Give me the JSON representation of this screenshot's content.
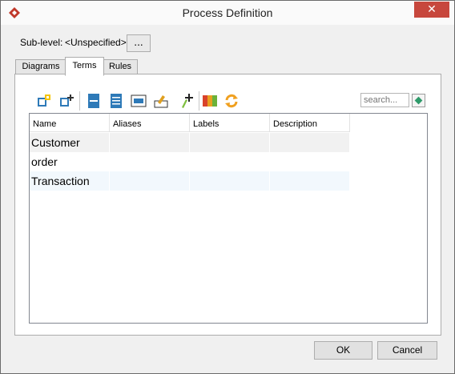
{
  "window": {
    "title": "Process Definition",
    "close_glyph": "✕"
  },
  "sublevel": {
    "label": "Sub-level:",
    "value": "<Unspecified>",
    "browse_label": "..."
  },
  "tabs": [
    {
      "label": "Diagrams"
    },
    {
      "label": "Terms",
      "active": true
    },
    {
      "label": "Rules"
    }
  ],
  "toolbar": {
    "icons": [
      "add-term-icon",
      "add-child-icon",
      "document-icon",
      "table-icon",
      "form-icon",
      "export-icon",
      "add-item-icon",
      "color-grid-icon",
      "refresh-icon"
    ],
    "search_placeholder": "search..."
  },
  "table": {
    "columns": [
      "Name",
      "Aliases",
      "Labels",
      "Description"
    ],
    "rows": [
      {
        "name": "Customer",
        "aliases": "",
        "labels": "",
        "description": ""
      },
      {
        "name": "order",
        "aliases": "",
        "labels": "",
        "description": ""
      },
      {
        "name": "Transaction",
        "aliases": "",
        "labels": "",
        "description": ""
      }
    ]
  },
  "buttons": {
    "ok": "OK",
    "cancel": "Cancel"
  },
  "colors": {
    "close": "#c7473d",
    "row_alt": "#f1f1f1",
    "row_blue": "#f2f8fd",
    "accent": "#2e7ab8"
  }
}
